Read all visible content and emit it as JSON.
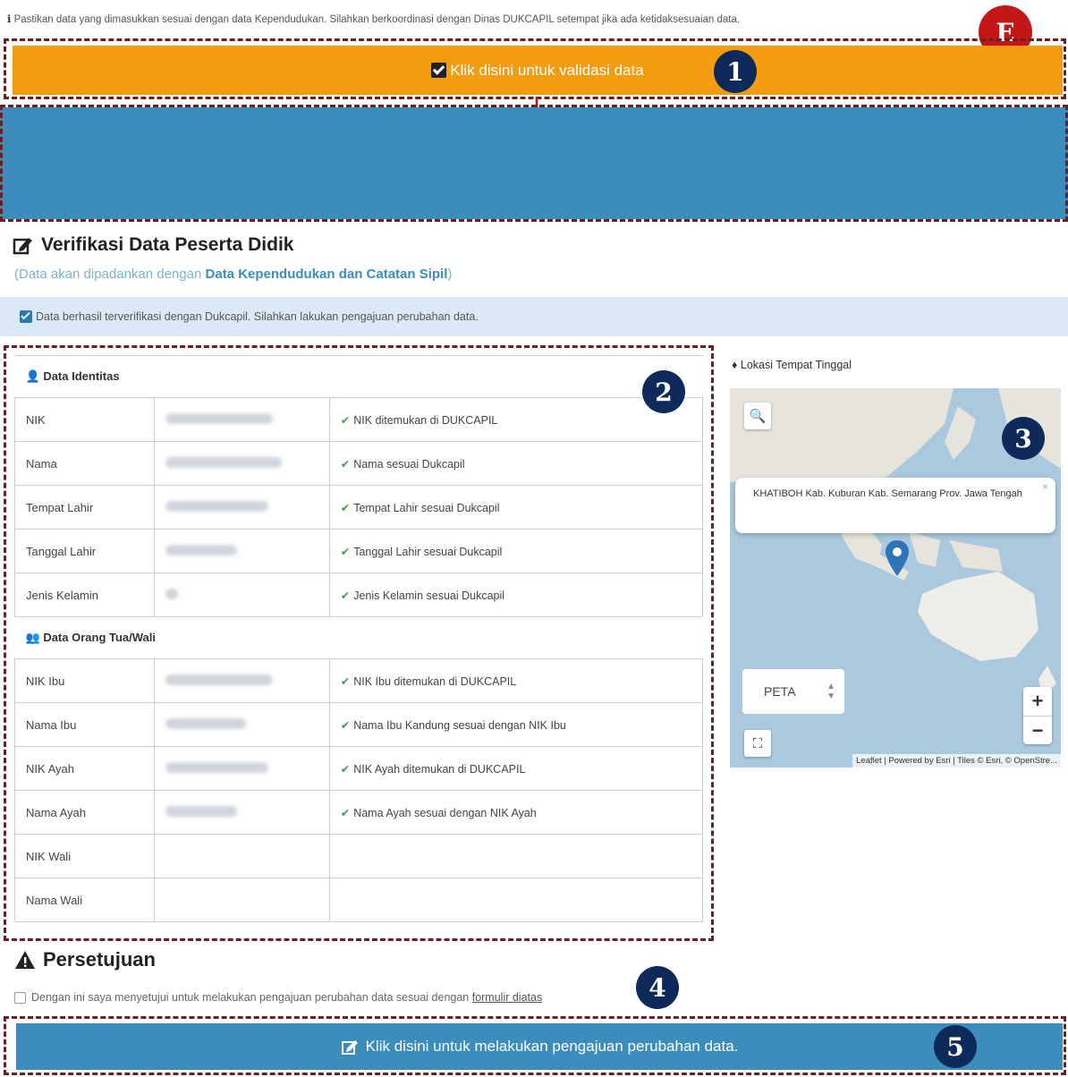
{
  "top_note": "Pastikan data yang dimasukkan sesuai dengan data Kependudukan. Silahkan berkoordinasi dengan Dinas DUKCAPIL setempat jika ada ketidaksesuaian data.",
  "validate_button": "Klik disini untuk validasi data",
  "badges": {
    "b1": "1",
    "b2": "2",
    "b3": "3",
    "b4": "4",
    "b5": "5",
    "e": "E"
  },
  "verification": {
    "title": "Verifikasi Data Peserta Didik",
    "subtitle_prefix": "(Data akan dipadankan dengan ",
    "subtitle_link": "Data Kependudukan dan Catatan Sipil",
    "subtitle_suffix": ")",
    "alert": "Data berhasil terverifikasi dengan Dukcapil. Silahkan lakukan pengajuan perubahan data."
  },
  "identity": {
    "section_label": "Data Identitas",
    "rows": [
      {
        "label": "NIK",
        "status": "NIK ditemukan di DUKCAPIL"
      },
      {
        "label": "Nama",
        "status": "Nama sesuai Dukcapil"
      },
      {
        "label": "Tempat Lahir",
        "status": "Tempat Lahir sesuai Dukcapil"
      },
      {
        "label": "Tanggal Lahir",
        "status": "Tanggal Lahir sesuai Dukcapil"
      },
      {
        "label": "Jenis Kelamin",
        "status": "Jenis Kelamin sesuai Dukcapil"
      }
    ]
  },
  "parents": {
    "section_label": "Data Orang Tua/Wali",
    "rows": [
      {
        "label": "NIK Ibu",
        "status": "NIK Ibu ditemukan di DUKCAPIL"
      },
      {
        "label": "Nama Ibu",
        "status": "Nama Ibu Kandung sesuai dengan NIK Ibu"
      },
      {
        "label": "NIK Ayah",
        "status": "NIK Ayah ditemukan di DUKCAPIL"
      },
      {
        "label": "Nama Ayah",
        "status": "Nama Ayah sesuai dengan NIK Ayah"
      },
      {
        "label": "NIK Wali",
        "status": ""
      },
      {
        "label": "Nama Wali",
        "status": ""
      }
    ]
  },
  "map": {
    "label": "Lokasi Tempat Tinggal",
    "popup": "KHATIBOH Kab. Kuburan Kab. Semarang Prov. Jawa Tengah",
    "layer_select": "PETA",
    "zoom_in": "+",
    "zoom_out": "−",
    "attribution": "Leaflet | Powered by Esri | Tiles © Esri, © OpenStre..."
  },
  "agreement": {
    "title": "Persetujuan",
    "consent_text": "Dengan ini saya menyetujui untuk melakukan pengajuan perubahan data sesuai dengan ",
    "consent_link": "formulir diatas"
  },
  "submit_button": "Klik disini untuk melakukan pengajuan perubahan data."
}
